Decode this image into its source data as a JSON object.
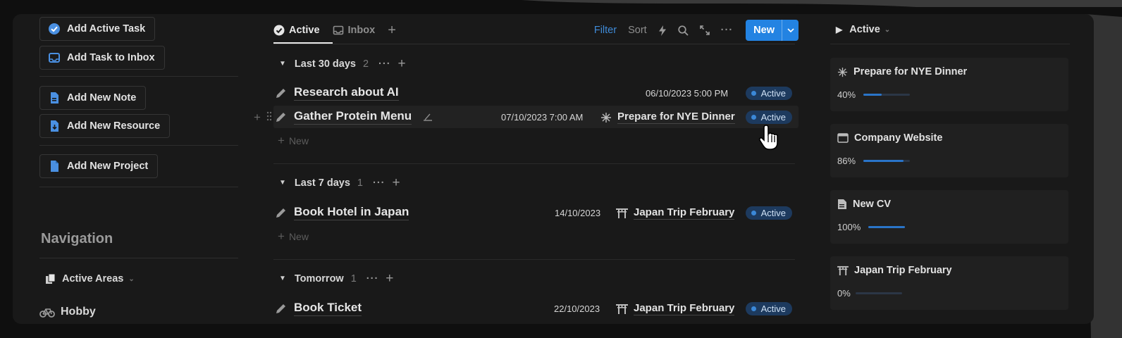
{
  "colors": {
    "accent": "#2383e2",
    "badge_bg": "#1d3a5e",
    "badge_dot": "#3b88d8",
    "progress": "#2a74c8"
  },
  "quick_actions": [
    {
      "label": "Add Active Task",
      "icon": "check-circle-icon"
    },
    {
      "label": "Add Task to Inbox",
      "icon": "inbox-icon"
    },
    {
      "label": "Add New Note",
      "icon": "note-icon"
    },
    {
      "label": "Add New Resource",
      "icon": "resource-download-icon"
    },
    {
      "label": "Add New Project",
      "icon": "project-doc-icon"
    }
  ],
  "navigation": {
    "title": "Navigation",
    "items": [
      {
        "label": "Active Areas",
        "icon": "copy-pages-icon"
      },
      {
        "label": "Hobby",
        "icon": "bicycle-icon"
      }
    ]
  },
  "tabs": {
    "active": "Active",
    "inbox": "Inbox"
  },
  "toolbar": {
    "filter": "Filter",
    "sort": "Sort",
    "new_label": "New"
  },
  "groups": [
    {
      "name": "Last 30 days",
      "count": "2",
      "new_label": "New",
      "tasks": [
        {
          "title": "Research about AI",
          "date": "06/10/2023 5:00 PM",
          "project": "",
          "status": "Active"
        },
        {
          "title": "Gather Protein Menu",
          "date": "07/10/2023 7:00 AM",
          "project": "Prepare for NYE Dinner",
          "status": "Active"
        }
      ]
    },
    {
      "name": "Last 7 days",
      "count": "1",
      "new_label": "New",
      "tasks": [
        {
          "title": "Book Hotel in Japan",
          "date": "14/10/2023",
          "project": "Japan Trip February",
          "status": "Active"
        }
      ]
    },
    {
      "name": "Tomorrow",
      "count": "1",
      "tasks": [
        {
          "title": "Book Ticket",
          "date": "22/10/2023",
          "project": "Japan Trip February",
          "status": "Active"
        }
      ]
    }
  ],
  "right_panel": {
    "title": "Active",
    "projects": [
      {
        "name": "Prepare for NYE Dinner",
        "icon": "sparkle-icon",
        "progress_label": "40%",
        "progress": 0.4
      },
      {
        "name": "Company Website",
        "icon": "browser-window-icon",
        "progress_label": "86%",
        "progress": 0.86
      },
      {
        "name": "New CV",
        "icon": "document-icon",
        "progress_label": "100%",
        "progress": 1.0
      },
      {
        "name": "Japan Trip February",
        "icon": "torii-gate-icon",
        "progress_label": "0%",
        "progress": 0.0
      }
    ]
  }
}
